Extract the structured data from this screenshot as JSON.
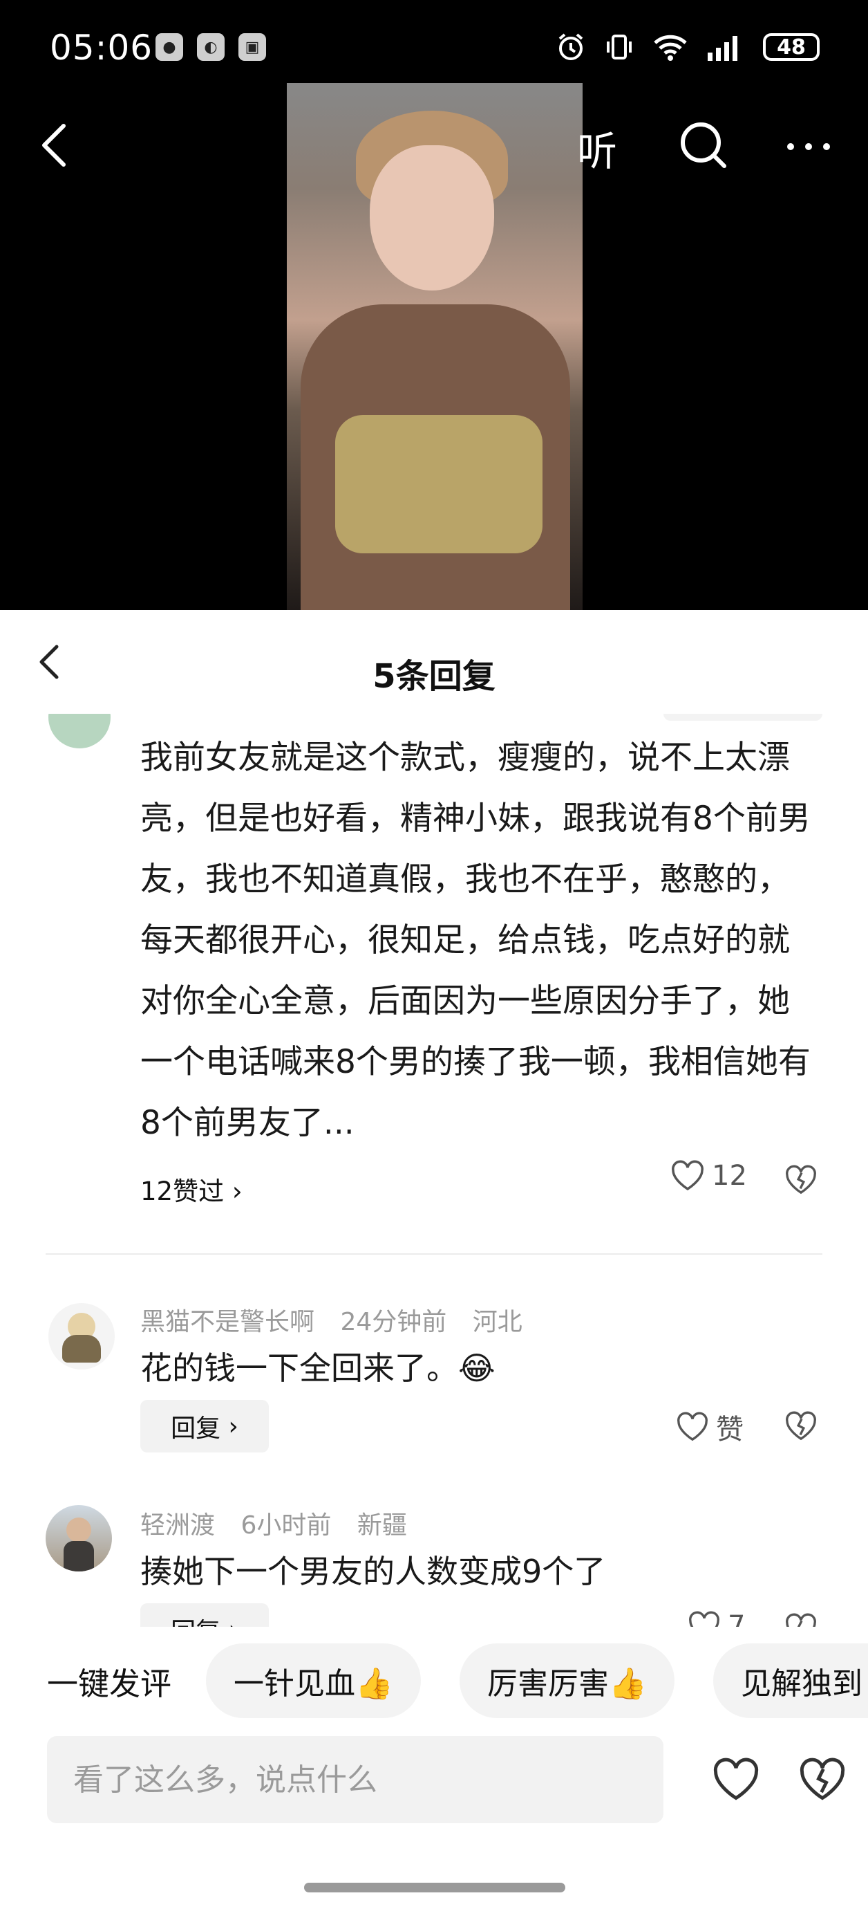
{
  "status_bar": {
    "time": "05:06",
    "battery": "48"
  },
  "top_nav": {
    "listen_label": "听"
  },
  "sheet": {
    "title": "5条回复"
  },
  "main_comment": {
    "text": "我前女友就是这个款式，瘦瘦的，说不上太漂亮，但是也好看，精神小妹，跟我说有8个前男友，我也不知道真假，我也不在乎，憨憨的，每天都很开心，很知足，给点钱，吃点好的就对你全心全意，后面因为一些原因分手了，她一个电话喊来8个男的揍了我一顿，我相信她有8个前男友了...",
    "liked_by": "12赞过",
    "like_count": "12"
  },
  "replies": [
    {
      "user": "黑猫不是警长啊",
      "time": "24分钟前",
      "location": "河北",
      "text": "花的钱一下全回来了。",
      "emoji": "😂",
      "reply_label": "回复",
      "like_label": "赞"
    },
    {
      "user": "轻洲渡",
      "time": "6小时前",
      "location": "新疆",
      "text": "揍她下一个男友的人数变成9个了",
      "reply_label": "回复",
      "like_label": "7"
    }
  ],
  "quick_comment": {
    "label": "一键发评",
    "chips": [
      "一针见血👍",
      "厉害厉害👍",
      "见解独到"
    ]
  },
  "input": {
    "placeholder": "看了这么多，说点什么"
  },
  "colors": {
    "top_bg": "#000000",
    "chip_bg": "#f3f3f3",
    "meta_gray": "#9a9a9a"
  }
}
